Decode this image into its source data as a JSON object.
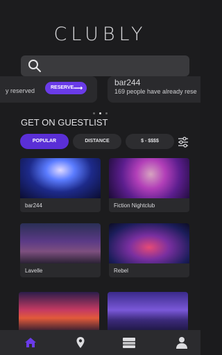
{
  "app": {
    "title": "CLUBLY"
  },
  "search": {
    "placeholder": ""
  },
  "carousel": {
    "left_card_text": "y reserved",
    "reserve_label": "RESERVE",
    "reserve_arrow": "⟶",
    "right_card_name": "bar244",
    "right_card_text": "169 people have already rese"
  },
  "section": {
    "title": "GET ON GUESTLIST"
  },
  "filters": [
    {
      "label": "POPULAR",
      "active": true
    },
    {
      "label": "DISTANCE",
      "active": false
    },
    {
      "label": "$ - $$$$",
      "active": false
    }
  ],
  "venues": [
    {
      "name": "bar244"
    },
    {
      "name": "Fiction Nightclub"
    },
    {
      "name": "Lavelle"
    },
    {
      "name": "Rebel"
    },
    {
      "name": ""
    },
    {
      "name": ""
    }
  ],
  "nav": [
    {
      "icon": "home-icon",
      "active": true
    },
    {
      "icon": "location-pin-icon",
      "active": false
    },
    {
      "icon": "tickets-icon",
      "active": false
    },
    {
      "icon": "profile-icon",
      "active": false
    }
  ],
  "colors": {
    "accent": "#5a2fd6",
    "background": "#1c1c1e",
    "nav_active": "#6a3be8"
  }
}
